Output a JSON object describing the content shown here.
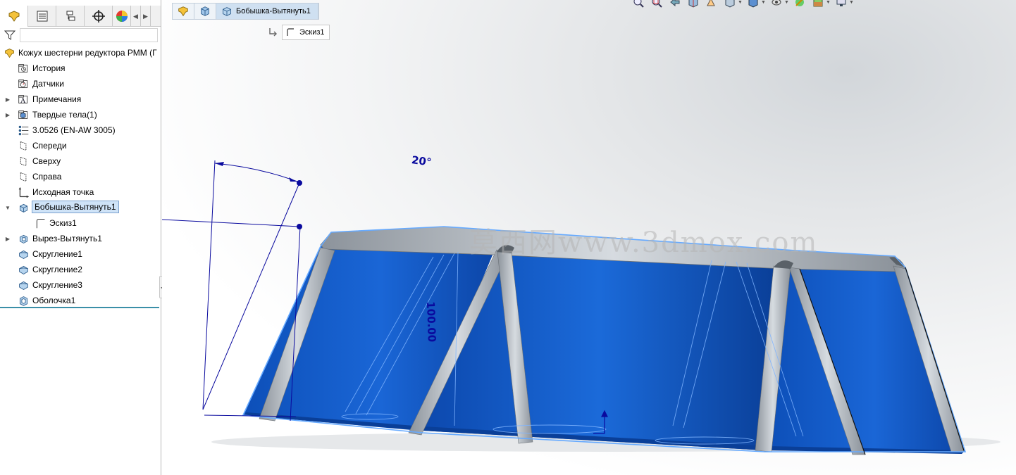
{
  "panel": {
    "tabs": [
      {
        "icon": "feature-manager-icon",
        "active": true
      },
      {
        "icon": "property-manager-icon",
        "active": false
      },
      {
        "icon": "configuration-manager-icon",
        "active": false
      },
      {
        "icon": "dimxpert-manager-icon",
        "active": false
      },
      {
        "icon": "display-manager-icon",
        "active": false
      }
    ],
    "filter_icon": "filter-icon"
  },
  "tree": {
    "root": {
      "label": "Кожух шестерни редуктора РММ  (Г",
      "icon": "part-icon"
    },
    "items": [
      {
        "label": "История",
        "icon": "history-icon",
        "expander": false
      },
      {
        "label": "Датчики",
        "icon": "sensors-icon",
        "expander": false
      },
      {
        "label": "Примечания",
        "icon": "annotations-icon",
        "expander": true
      },
      {
        "label": "Твердые тела(1)",
        "icon": "solid-bodies-icon",
        "expander": true
      },
      {
        "label": "3.0526 (EN-AW 3005)",
        "icon": "material-icon",
        "expander": false
      },
      {
        "label": "Спереди",
        "icon": "plane-icon",
        "expander": false
      },
      {
        "label": "Сверху",
        "icon": "plane-icon",
        "expander": false
      },
      {
        "label": "Справа",
        "icon": "plane-icon",
        "expander": false
      },
      {
        "label": "Исходная точка",
        "icon": "origin-icon",
        "expander": false
      },
      {
        "label": "Бобышка-Вытянуть1",
        "icon": "boss-extrude-icon",
        "expander": "open",
        "selected": true
      },
      {
        "label": "Эскиз1",
        "icon": "sketch-icon",
        "expander": false,
        "child": true
      },
      {
        "label": "Вырез-Вытянуть1",
        "icon": "cut-extrude-icon",
        "expander": true
      },
      {
        "label": "Скругление1",
        "icon": "fillet-icon",
        "expander": false
      },
      {
        "label": "Скругление2",
        "icon": "fillet-icon",
        "expander": false
      },
      {
        "label": "Скругление3",
        "icon": "fillet-icon",
        "expander": false
      },
      {
        "label": "Оболочка1",
        "icon": "shell-icon",
        "expander": false
      }
    ]
  },
  "breadcrumb": {
    "segments": [
      {
        "icon": "part-icon"
      },
      {
        "icon": "solid-body-icon"
      },
      {
        "icon": "boss-extrude-icon",
        "label": "Бобышка-Вытянуть1"
      }
    ],
    "sub_item": {
      "icon": "sketch-icon",
      "label": "Эскиз1"
    }
  },
  "viewport": {
    "dimension_angle": "20°",
    "dimension_length": "100.00",
    "watermark": "莫西网www.3dmox.com",
    "colors": {
      "body": "#1559c6",
      "edge_highlight": "#66aaff",
      "fillet": "#a7adb4",
      "sketch": "#0a0a9e"
    }
  },
  "hud_icons": [
    "zoom-to-fit-icon",
    "zoom-to-area-icon",
    "previous-view-icon",
    "section-view-icon",
    "dynamic-annotation-icon",
    "view-orientation-icon",
    "display-style-icon",
    "hide-show-icon",
    "edit-appearance-icon",
    "apply-scene-icon",
    "view-settings-icon"
  ]
}
